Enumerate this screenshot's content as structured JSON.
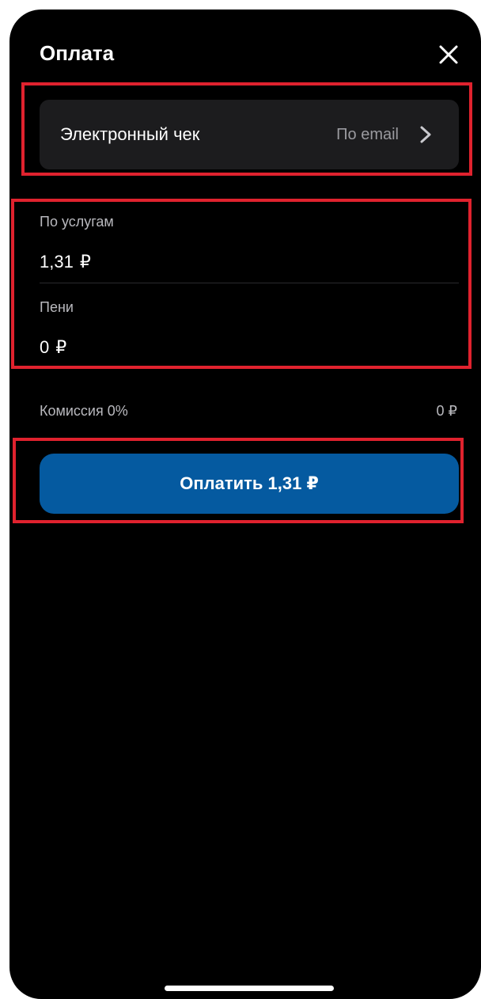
{
  "header": {
    "title": "Оплата"
  },
  "receipt": {
    "label": "Электронный чек",
    "value": "По email"
  },
  "fields": [
    {
      "label": "По услугам",
      "amount": "1,31",
      "currency": "₽"
    },
    {
      "label": "Пени",
      "amount": "0",
      "currency": "₽"
    }
  ],
  "commission": {
    "label": "Комиссия 0%",
    "value": "0 ₽"
  },
  "pay_button": {
    "label": "Оплатить 1,31 ₽"
  },
  "colors": {
    "background": "#000000",
    "card": "#1c1c1e",
    "accent_button": "#055aa0",
    "highlight": "#e0222e"
  },
  "icons": {
    "close": "close-icon",
    "chevron": "chevron-right-icon"
  }
}
